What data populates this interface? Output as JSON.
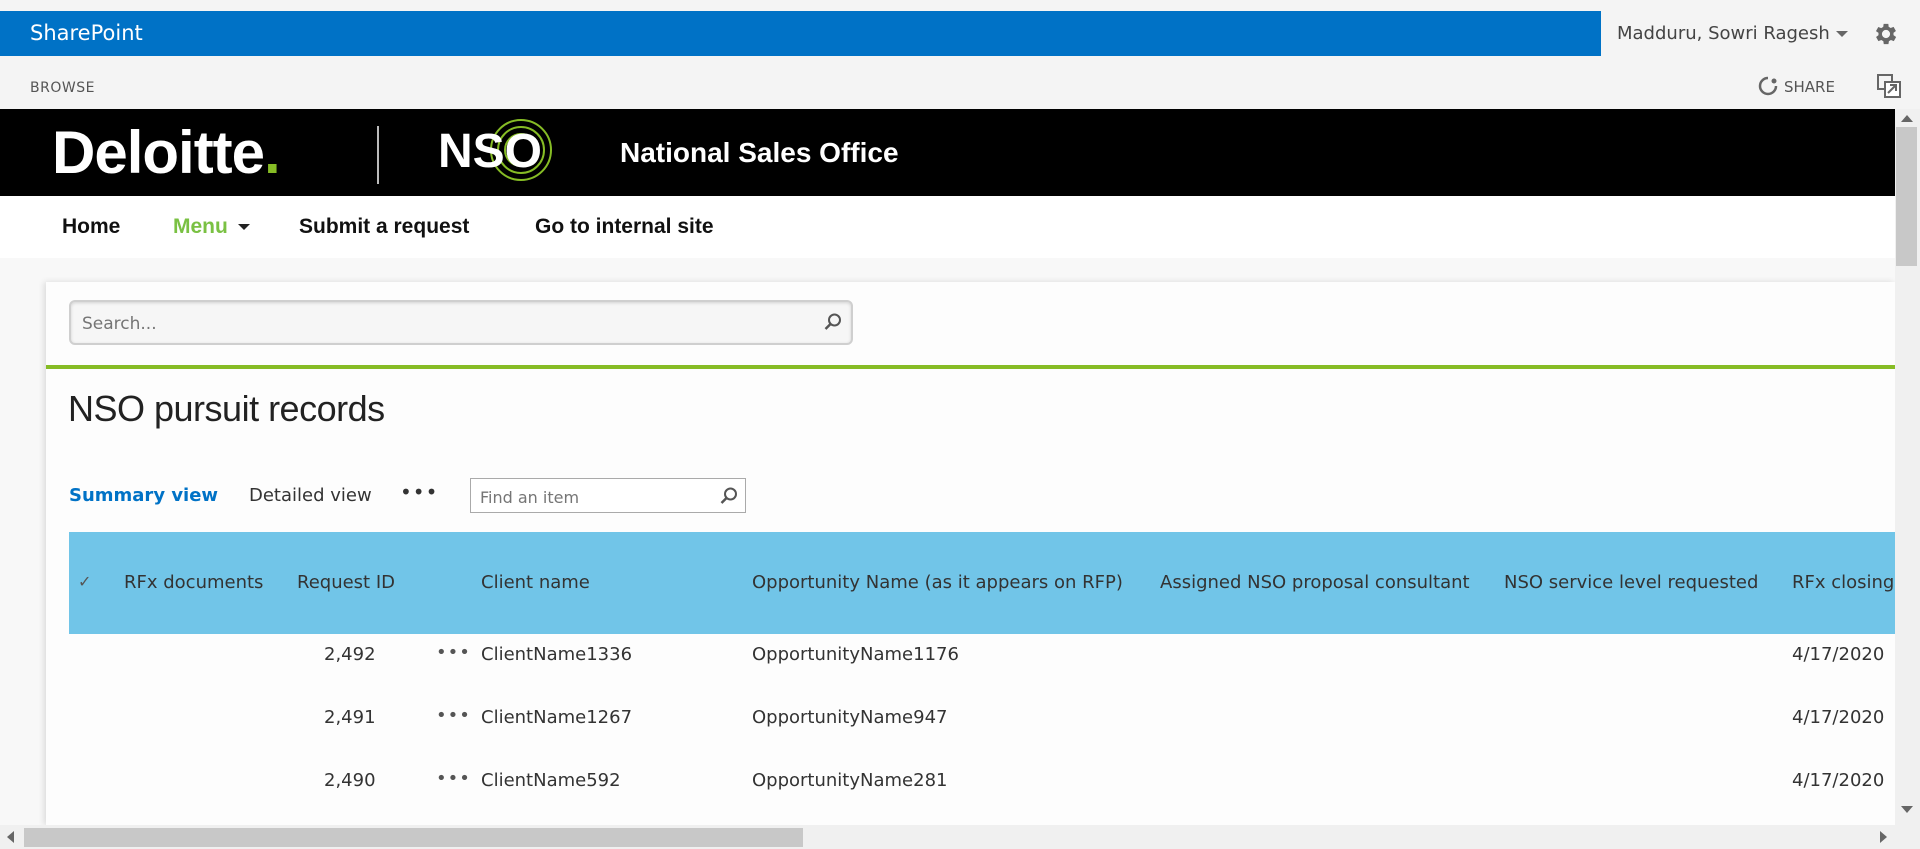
{
  "suitebar": {
    "brand": "SharePoint",
    "user_name": "Madduru, Sowri Ragesh",
    "settings_icon": "gear-icon"
  },
  "ribbon": {
    "browse_tab": "BROWSE",
    "share_label": "SHARE"
  },
  "banner": {
    "logo_text": "Deloitte",
    "logo_dot": ".",
    "nso_logo": "NSO",
    "site_title": "National Sales Office",
    "colors": {
      "background": "#000000",
      "accent": "#86bc25"
    }
  },
  "topnav": {
    "items": [
      {
        "label": "Home"
      },
      {
        "label": "Menu"
      },
      {
        "label": "Submit a request"
      },
      {
        "label": "Go to internal site"
      }
    ]
  },
  "search": {
    "placeholder": "Search..."
  },
  "page": {
    "title": "NSO pursuit records"
  },
  "views": {
    "summary": "Summary view",
    "detailed": "Detailed view",
    "more": "•••",
    "find_placeholder": "Find an item"
  },
  "list": {
    "header_color": "#71c5e8",
    "check_glyph": "✓",
    "columns": [
      "RFx documents",
      "Request ID",
      "Client name",
      "Opportunity Name (as it appears on RFP)",
      "Assigned NSO proposal consultant",
      "NSO service level requested",
      "RFx closing"
    ],
    "rows": [
      {
        "request_id": "2,492",
        "menu": "•••",
        "client": "ClientName1336",
        "opportunity": "OpportunityName1176",
        "closing": "4/17/2020"
      },
      {
        "request_id": "2,491",
        "menu": "•••",
        "client": "ClientName1267",
        "opportunity": "OpportunityName947",
        "closing": "4/17/2020"
      },
      {
        "request_id": "2,490",
        "menu": "•••",
        "client": "ClientName592",
        "opportunity": "OpportunityName281",
        "closing": "4/17/2020"
      }
    ]
  }
}
